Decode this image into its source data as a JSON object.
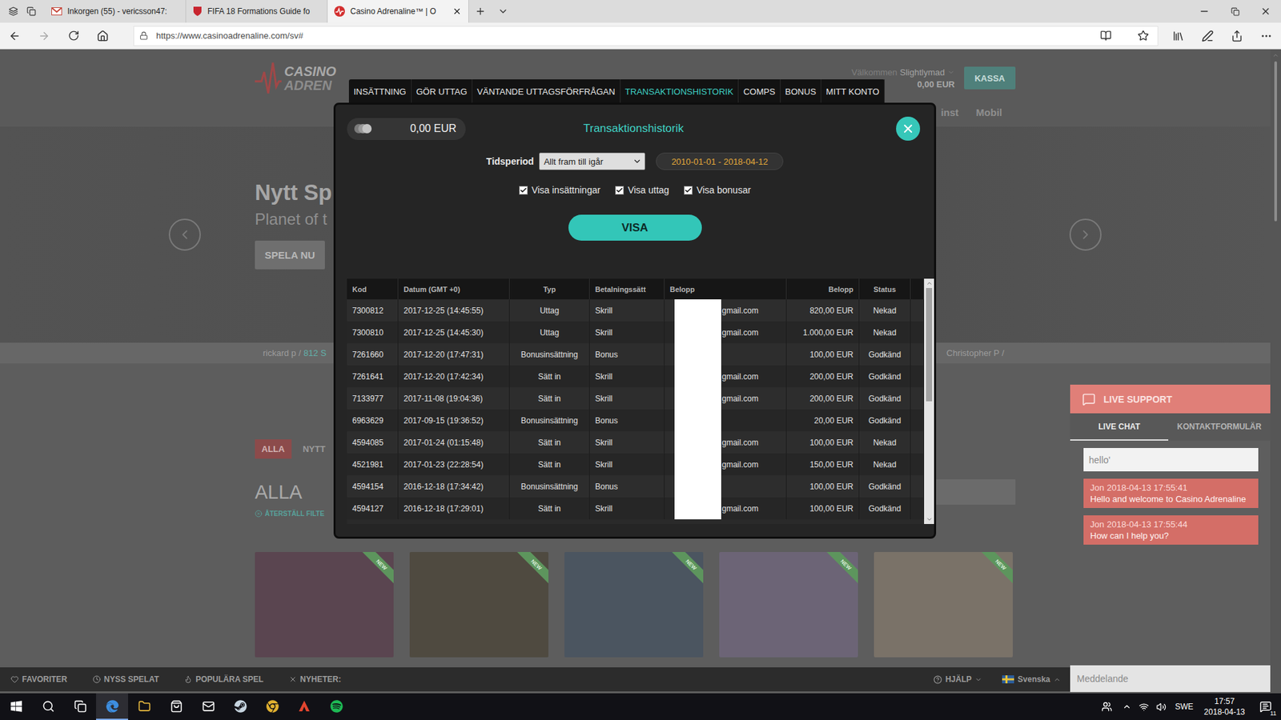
{
  "browser": {
    "tabs": [
      {
        "label": "Inkorgen (55) - vericsson47:",
        "selected": false
      },
      {
        "label": "FIFA 18 Formations Guide fo",
        "selected": false
      },
      {
        "label": "Casino Adrenaline™ | O",
        "selected": true
      }
    ],
    "address": "https://www.casinoadrenaline.com/sv#"
  },
  "site": {
    "logo": {
      "top": "CASINO",
      "bottom": "ADREN"
    },
    "welcome": "Välkommen",
    "username": "Slightlymad",
    "balance": "0,00 EUR",
    "cashier": "KASSA",
    "nav": [
      "inst",
      "Mobil"
    ],
    "hero": {
      "title": "Nytt Sp",
      "subtitle": "Planet of t",
      "button": "SPELA NU"
    },
    "ticker": [
      {
        "name": "rickard p /",
        "win": "812 S"
      },
      {
        "name": "Christopher P /",
        "win": ""
      }
    ],
    "filters": [
      {
        "label": "ALLA",
        "selected": true
      },
      {
        "label": "NYTT",
        "selected": false
      }
    ],
    "section_title": "ALLA",
    "reset": "ÅTERSTÄLL FILTE",
    "games": [
      {
        "badge": "NEW",
        "color": "#5a4550"
      },
      {
        "badge": "NEW",
        "color": "#4f4a40"
      },
      {
        "badge": "NEW",
        "color": "#4b5560"
      },
      {
        "badge": "NEW",
        "color": "#6c6476"
      },
      {
        "badge": "NEW",
        "color": "#7a7268"
      }
    ],
    "footer": {
      "items": [
        "FAVORITER",
        "NYSS SPELAT",
        "POPULÄRA SPEL",
        "NYHETER:"
      ],
      "help": "HJÄLP",
      "language": "Svenska"
    }
  },
  "chat": {
    "title": "LIVE SUPPORT",
    "tabs": [
      {
        "label": "LIVE CHAT",
        "selected": true
      },
      {
        "label": "KONTAKTFORMULÄR",
        "selected": false
      }
    ],
    "input": "hello'",
    "messages": [
      {
        "author": "Jon",
        "time": "2018-04-13 17:55:41",
        "text": "Hello and welcome to Casino Adrenaline"
      },
      {
        "author": "Jon",
        "time": "2018-04-13 17:55:44",
        "text": "How can I help you?"
      }
    ],
    "compose_placeholder": "Meddelande"
  },
  "modal": {
    "tabs": [
      {
        "label": "INSÄTTNING",
        "selected": false
      },
      {
        "label": "GÖR UTTAG",
        "selected": false
      },
      {
        "label": "VÄNTANDE UTTAGSFÖRFRÅGAN",
        "selected": false
      },
      {
        "label": "TRANSAKTIONSHISTORIK",
        "selected": true
      },
      {
        "label": "COMPS",
        "selected": false
      },
      {
        "label": "BONUS",
        "selected": false
      },
      {
        "label": "MITT KONTO",
        "selected": false
      }
    ],
    "balance": "0,00 EUR",
    "title": "Transaktionshistorik",
    "period_label": "Tidsperiod",
    "period_value": "Allt fram till igår",
    "date_range": "2010-01-01 - 2018-04-12",
    "filters": [
      {
        "label": "Visa insättningar",
        "checked": true
      },
      {
        "label": "Visa uttag",
        "checked": true
      },
      {
        "label": "Visa bonusar",
        "checked": true
      }
    ],
    "submit": "VISA",
    "table": {
      "columns": [
        "Kod",
        "Datum (GMT +0)",
        "Typ",
        "Betalningssätt",
        "Belopp",
        "Belopp",
        "Status"
      ],
      "rows": [
        {
          "code": "7300812",
          "date": "2017-12-25 (14:45:55)",
          "type": "Uttag",
          "method": "Skrill",
          "account": "gmail.com",
          "amount": "820,00 EUR",
          "status": "Nekad"
        },
        {
          "code": "7300810",
          "date": "2017-12-25 (14:45:30)",
          "type": "Uttag",
          "method": "Skrill",
          "account": "gmail.com",
          "amount": "1.000,00 EUR",
          "status": "Nekad"
        },
        {
          "code": "7261660",
          "date": "2017-12-20 (17:47:31)",
          "type": "Bonusinsättning",
          "method": "Bonus",
          "account": "",
          "amount": "100,00 EUR",
          "status": "Godkänd"
        },
        {
          "code": "7261641",
          "date": "2017-12-20 (17:42:34)",
          "type": "Sätt in",
          "method": "Skrill",
          "account": "gmail.com",
          "amount": "200,00 EUR",
          "status": "Godkänd"
        },
        {
          "code": "7133977",
          "date": "2017-11-08 (19:04:36)",
          "type": "Sätt in",
          "method": "Skrill",
          "account": "gmail.com",
          "amount": "200,00 EUR",
          "status": "Godkänd"
        },
        {
          "code": "6963629",
          "date": "2017-09-15 (19:36:52)",
          "type": "Bonusinsättning",
          "method": "Bonus",
          "account": "",
          "amount": "20,00 EUR",
          "status": "Godkänd"
        },
        {
          "code": "4594085",
          "date": "2017-01-24 (01:15:48)",
          "type": "Sätt in",
          "method": "Skrill",
          "account": "gmail.com",
          "amount": "100,00 EUR",
          "status": "Nekad"
        },
        {
          "code": "4521981",
          "date": "2017-01-23 (22:28:54)",
          "type": "Sätt in",
          "method": "Skrill",
          "account": "gmail.com",
          "amount": "150,00 EUR",
          "status": "Nekad"
        },
        {
          "code": "4594154",
          "date": "2016-12-18 (17:34:42)",
          "type": "Bonusinsättning",
          "method": "Bonus",
          "account": "",
          "amount": "100,00 EUR",
          "status": "Godkänd"
        },
        {
          "code": "4594127",
          "date": "2016-12-18 (17:29:01)",
          "type": "Sätt in",
          "method": "Skrill",
          "account": "gmail.com",
          "amount": "100,00 EUR",
          "status": "Godkänd"
        }
      ]
    }
  },
  "taskbar": {
    "apps": [
      {
        "selected": false
      },
      {
        "selected": false
      },
      {
        "selected": false
      },
      {
        "selected": true
      },
      {
        "selected": false
      },
      {
        "selected": false
      },
      {
        "selected": false
      },
      {
        "selected": false
      },
      {
        "selected": false
      },
      {
        "selected": false
      },
      {
        "selected": false
      }
    ],
    "language": "SWE",
    "time": "17:57",
    "date": "2018-04-13",
    "notifications": "11"
  }
}
